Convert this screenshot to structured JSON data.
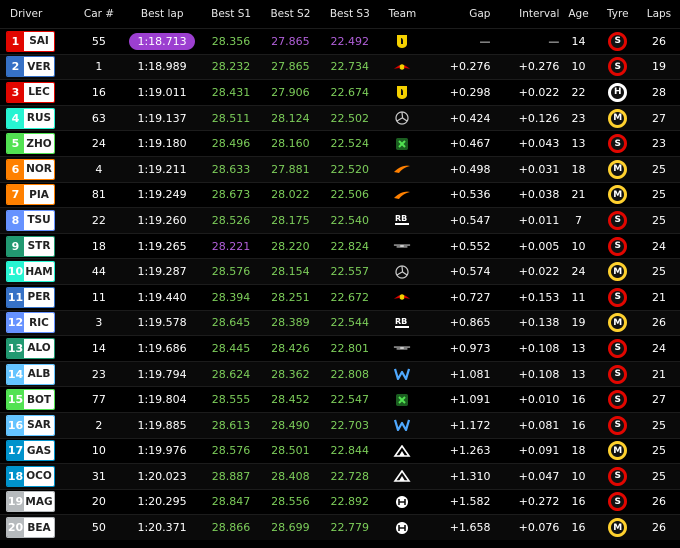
{
  "headers": {
    "driver": "Driver",
    "car": "Car #",
    "best": "Best lap",
    "s1": "Best S1",
    "s2": "Best S2",
    "s3": "Best S3",
    "team": "Team",
    "gap": "Gap",
    "interval": "Interval",
    "age": "Age",
    "tyre": "Tyre",
    "laps": "Laps"
  },
  "rows": [
    {
      "pos": "1",
      "code": "SAI",
      "color": "#e10600",
      "car": "55",
      "best": "1:18.713",
      "best_style": "pill",
      "s1": "28.356",
      "s1c": "green",
      "s2": "27.865",
      "s2c": "purple",
      "s3": "22.492",
      "s3c": "purple",
      "team": "ferrari",
      "gap": "—",
      "interval": "—",
      "age": "14",
      "tyre": "S",
      "tyre_color": "#e10600",
      "laps": "26"
    },
    {
      "pos": "2",
      "code": "VER",
      "color": "#3671c6",
      "car": "1",
      "best": "1:18.989",
      "best_style": "white",
      "s1": "28.232",
      "s1c": "green",
      "s2": "27.865",
      "s2c": "green",
      "s3": "22.734",
      "s3c": "green",
      "team": "redbull",
      "gap": "+0.276",
      "interval": "+0.276",
      "age": "10",
      "tyre": "S",
      "tyre_color": "#e10600",
      "laps": "19"
    },
    {
      "pos": "3",
      "code": "LEC",
      "color": "#e10600",
      "car": "16",
      "best": "1:19.011",
      "best_style": "white",
      "s1": "28.431",
      "s1c": "green",
      "s2": "27.906",
      "s2c": "green",
      "s3": "22.674",
      "s3c": "green",
      "team": "ferrari",
      "gap": "+0.298",
      "interval": "+0.022",
      "age": "22",
      "tyre": "H",
      "tyre_color": "#ffffff",
      "laps": "28"
    },
    {
      "pos": "4",
      "code": "RUS",
      "color": "#27f4d2",
      "car": "63",
      "best": "1:19.137",
      "best_style": "white",
      "s1": "28.511",
      "s1c": "green",
      "s2": "28.124",
      "s2c": "green",
      "s3": "22.502",
      "s3c": "green",
      "team": "mercedes",
      "gap": "+0.424",
      "interval": "+0.126",
      "age": "23",
      "tyre": "M",
      "tyre_color": "#ffd12e",
      "laps": "27"
    },
    {
      "pos": "5",
      "code": "ZHO",
      "color": "#52e252",
      "car": "24",
      "best": "1:19.180",
      "best_style": "white",
      "s1": "28.496",
      "s1c": "green",
      "s2": "28.160",
      "s2c": "green",
      "s3": "22.524",
      "s3c": "green",
      "team": "sauber",
      "gap": "+0.467",
      "interval": "+0.043",
      "age": "13",
      "tyre": "S",
      "tyre_color": "#e10600",
      "laps": "23"
    },
    {
      "pos": "6",
      "code": "NOR",
      "color": "#ff8000",
      "car": "4",
      "best": "1:19.211",
      "best_style": "white",
      "s1": "28.633",
      "s1c": "green",
      "s2": "27.881",
      "s2c": "green",
      "s3": "22.520",
      "s3c": "green",
      "team": "mclaren",
      "gap": "+0.498",
      "interval": "+0.031",
      "age": "18",
      "tyre": "M",
      "tyre_color": "#ffd12e",
      "laps": "25"
    },
    {
      "pos": "7",
      "code": "PIA",
      "color": "#ff8000",
      "car": "81",
      "best": "1:19.249",
      "best_style": "white",
      "s1": "28.673",
      "s1c": "green",
      "s2": "28.022",
      "s2c": "green",
      "s3": "22.506",
      "s3c": "green",
      "team": "mclaren",
      "gap": "+0.536",
      "interval": "+0.038",
      "age": "21",
      "tyre": "M",
      "tyre_color": "#ffd12e",
      "laps": "25"
    },
    {
      "pos": "8",
      "code": "TSU",
      "color": "#6692ff",
      "car": "22",
      "best": "1:19.260",
      "best_style": "white",
      "s1": "28.526",
      "s1c": "green",
      "s2": "28.175",
      "s2c": "green",
      "s3": "22.540",
      "s3c": "green",
      "team": "rb",
      "gap": "+0.547",
      "interval": "+0.011",
      "age": "7",
      "tyre": "S",
      "tyre_color": "#e10600",
      "laps": "25"
    },
    {
      "pos": "9",
      "code": "STR",
      "color": "#229971",
      "car": "18",
      "best": "1:19.265",
      "best_style": "white",
      "s1": "28.221",
      "s1c": "purple",
      "s2": "28.220",
      "s2c": "green",
      "s3": "22.824",
      "s3c": "green",
      "team": "astonmartin",
      "gap": "+0.552",
      "interval": "+0.005",
      "age": "10",
      "tyre": "S",
      "tyre_color": "#e10600",
      "laps": "24"
    },
    {
      "pos": "10",
      "code": "HAM",
      "color": "#27f4d2",
      "car": "44",
      "best": "1:19.287",
      "best_style": "white",
      "s1": "28.576",
      "s1c": "green",
      "s2": "28.154",
      "s2c": "green",
      "s3": "22.557",
      "s3c": "green",
      "team": "mercedes",
      "gap": "+0.574",
      "interval": "+0.022",
      "age": "24",
      "tyre": "M",
      "tyre_color": "#ffd12e",
      "laps": "25"
    },
    {
      "pos": "11",
      "code": "PER",
      "color": "#3671c6",
      "car": "11",
      "best": "1:19.440",
      "best_style": "white",
      "s1": "28.394",
      "s1c": "green",
      "s2": "28.251",
      "s2c": "green",
      "s3": "22.672",
      "s3c": "green",
      "team": "redbull",
      "gap": "+0.727",
      "interval": "+0.153",
      "age": "11",
      "tyre": "S",
      "tyre_color": "#e10600",
      "laps": "21"
    },
    {
      "pos": "12",
      "code": "RIC",
      "color": "#6692ff",
      "car": "3",
      "best": "1:19.578",
      "best_style": "white",
      "s1": "28.645",
      "s1c": "green",
      "s2": "28.389",
      "s2c": "green",
      "s3": "22.544",
      "s3c": "green",
      "team": "rb",
      "gap": "+0.865",
      "interval": "+0.138",
      "age": "19",
      "tyre": "M",
      "tyre_color": "#ffd12e",
      "laps": "26"
    },
    {
      "pos": "13",
      "code": "ALO",
      "color": "#229971",
      "car": "14",
      "best": "1:19.686",
      "best_style": "white",
      "s1": "28.445",
      "s1c": "green",
      "s2": "28.426",
      "s2c": "green",
      "s3": "22.801",
      "s3c": "green",
      "team": "astonmartin",
      "gap": "+0.973",
      "interval": "+0.108",
      "age": "13",
      "tyre": "S",
      "tyre_color": "#e10600",
      "laps": "24"
    },
    {
      "pos": "14",
      "code": "ALB",
      "color": "#64c4ff",
      "car": "23",
      "best": "1:19.794",
      "best_style": "white",
      "s1": "28.624",
      "s1c": "green",
      "s2": "28.362",
      "s2c": "green",
      "s3": "22.808",
      "s3c": "green",
      "team": "williams",
      "gap": "+1.081",
      "interval": "+0.108",
      "age": "13",
      "tyre": "S",
      "tyre_color": "#e10600",
      "laps": "21"
    },
    {
      "pos": "15",
      "code": "BOT",
      "color": "#52e252",
      "car": "77",
      "best": "1:19.804",
      "best_style": "white",
      "s1": "28.555",
      "s1c": "green",
      "s2": "28.452",
      "s2c": "green",
      "s3": "22.547",
      "s3c": "green",
      "team": "sauber",
      "gap": "+1.091",
      "interval": "+0.010",
      "age": "16",
      "tyre": "S",
      "tyre_color": "#e10600",
      "laps": "27"
    },
    {
      "pos": "16",
      "code": "SAR",
      "color": "#64c4ff",
      "car": "2",
      "best": "1:19.885",
      "best_style": "white",
      "s1": "28.613",
      "s1c": "green",
      "s2": "28.490",
      "s2c": "green",
      "s3": "22.703",
      "s3c": "green",
      "team": "williams",
      "gap": "+1.172",
      "interval": "+0.081",
      "age": "16",
      "tyre": "S",
      "tyre_color": "#e10600",
      "laps": "25"
    },
    {
      "pos": "17",
      "code": "GAS",
      "color": "#0093cc",
      "car": "10",
      "best": "1:19.976",
      "best_style": "white",
      "s1": "28.576",
      "s1c": "green",
      "s2": "28.501",
      "s2c": "green",
      "s3": "22.844",
      "s3c": "green",
      "team": "alpine",
      "gap": "+1.263",
      "interval": "+0.091",
      "age": "18",
      "tyre": "M",
      "tyre_color": "#ffd12e",
      "laps": "25"
    },
    {
      "pos": "18",
      "code": "OCO",
      "color": "#0093cc",
      "car": "31",
      "best": "1:20.023",
      "best_style": "white",
      "s1": "28.887",
      "s1c": "green",
      "s2": "28.408",
      "s2c": "green",
      "s3": "22.728",
      "s3c": "green",
      "team": "alpine",
      "gap": "+1.310",
      "interval": "+0.047",
      "age": "10",
      "tyre": "S",
      "tyre_color": "#e10600",
      "laps": "25"
    },
    {
      "pos": "19",
      "code": "MAG",
      "color": "#b6babd",
      "car": "20",
      "best": "1:20.295",
      "best_style": "white",
      "s1": "28.847",
      "s1c": "green",
      "s2": "28.556",
      "s2c": "green",
      "s3": "22.892",
      "s3c": "green",
      "team": "haas",
      "gap": "+1.582",
      "interval": "+0.272",
      "age": "16",
      "tyre": "S",
      "tyre_color": "#e10600",
      "laps": "26"
    },
    {
      "pos": "20",
      "code": "BEA",
      "color": "#b6babd",
      "car": "50",
      "best": "1:20.371",
      "best_style": "white",
      "s1": "28.866",
      "s1c": "green",
      "s2": "28.699",
      "s2c": "green",
      "s3": "22.779",
      "s3c": "green",
      "team": "haas",
      "gap": "+1.658",
      "interval": "+0.076",
      "age": "16",
      "tyre": "M",
      "tyre_color": "#ffd12e",
      "laps": "26"
    }
  ],
  "team_icons": {
    "ferrari": "ferrari-icon",
    "redbull": "redbull-icon",
    "mercedes": "mercedes-icon",
    "sauber": "sauber-icon",
    "mclaren": "mclaren-icon",
    "rb": "rb-icon",
    "astonmartin": "astonmartin-icon",
    "williams": "williams-icon",
    "alpine": "alpine-icon",
    "haas": "haas-icon"
  }
}
